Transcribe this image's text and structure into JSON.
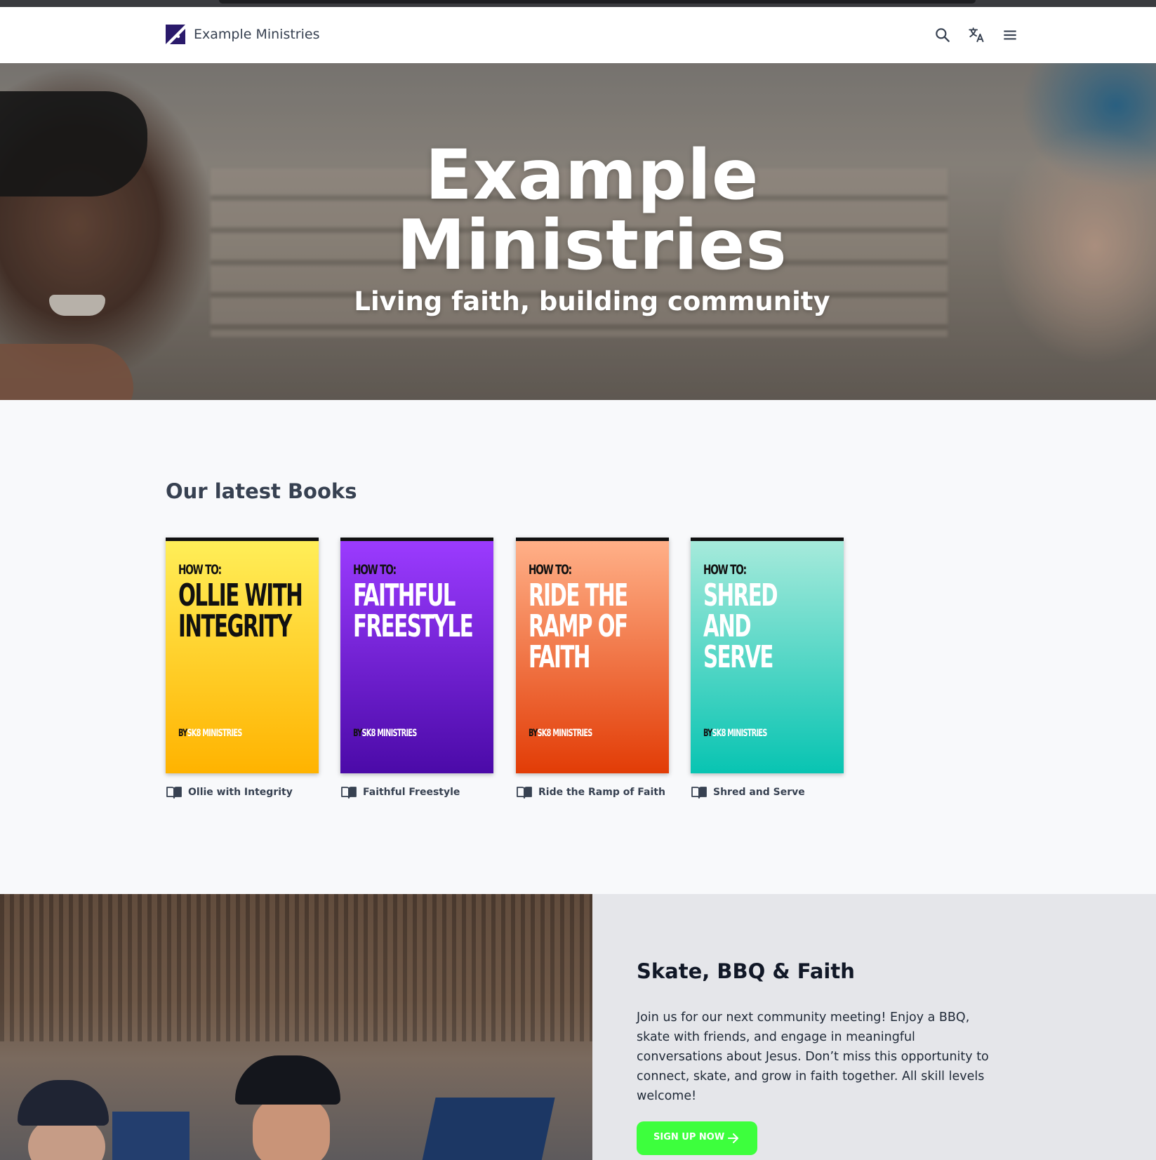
{
  "header": {
    "brand": "Example Ministries"
  },
  "hero": {
    "title_line1": "Example",
    "title_line2": "Ministries",
    "subtitle": "Living faith, building community"
  },
  "books": {
    "section_title": "Our latest Books",
    "items": [
      {
        "howto": "HOW TO:",
        "cover_line1": "OLLIE WITH",
        "cover_line2": "INTEGRITY",
        "cover_line3": "",
        "by": "BY",
        "publisher": "SK8 MINISTRIES",
        "caption": "Ollie with Integrity",
        "color_top": "#ffee58",
        "color_bottom": "#ffb300",
        "title_color": "#111111",
        "by_color": "#ffffff"
      },
      {
        "howto": "HOW TO:",
        "cover_line1": "FAITHFUL",
        "cover_line2": "FREESTYLE",
        "cover_line3": "",
        "by": "BY",
        "publisher": "SK8 MINISTRIES",
        "caption": "Faithful Freestyle",
        "color_top": "#9b3bff",
        "color_bottom": "#4b0aa8",
        "title_color": "#ffffff",
        "by_color": "#ffffff"
      },
      {
        "howto": "HOW TO:",
        "cover_line1": "RIDE THE",
        "cover_line2": "RAMP OF",
        "cover_line3": "FAITH",
        "by": "BY",
        "publisher": "SK8 MINISTRIES",
        "caption": "Ride the Ramp of Faith",
        "color_top": "#ffb088",
        "color_bottom": "#e23c06",
        "title_color": "#ffffff",
        "by_color": "#ffffff"
      },
      {
        "howto": "HOW TO:",
        "cover_line1": "SHRED AND",
        "cover_line2": "SERVE",
        "cover_line3": "",
        "by": "BY",
        "publisher": "SK8 MINISTRIES",
        "caption": "Shred and Serve",
        "color_top": "#a6eadb",
        "color_bottom": "#08c4b2",
        "title_color": "#ffffff",
        "by_color": "#ffffff"
      }
    ]
  },
  "event": {
    "title": "Skate, BBQ & Faith",
    "text": "Join us for our next community meeting! Enjoy a BBQ, skate with friends, and engage in meaningful conversations about Jesus. Don’t miss this opportunity to connect, skate, and grow in faith together. All skill levels welcome!",
    "button_label": "SIGN UP NOW"
  },
  "icons": {
    "search": "search-icon",
    "translate": "translate-icon",
    "menu": "menu-icon",
    "book": "book-open-icon",
    "arrow": "arrow-right-icon"
  },
  "colors": {
    "accent_button": "#3dff3d",
    "logo_bg": "#2a1a6b"
  }
}
